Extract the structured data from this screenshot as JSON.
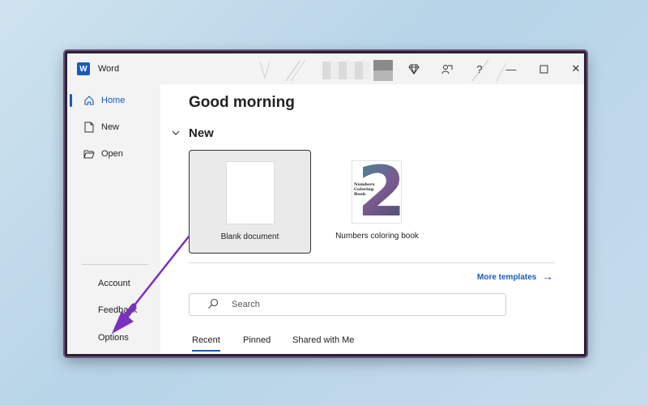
{
  "app": {
    "name": "Word",
    "icon_letter": "W"
  },
  "titlebar": {
    "buttons": [
      "diamond-icon",
      "coauthor-icon",
      "help-icon",
      "minimize-icon",
      "maximize-icon",
      "close-icon"
    ],
    "help_label": "?",
    "minimize_label": "—",
    "close_label": "✕"
  },
  "sidebar": {
    "items": [
      {
        "label": "Home",
        "icon": "home-icon",
        "active": true
      },
      {
        "label": "New",
        "icon": "new-document-icon",
        "active": false
      },
      {
        "label": "Open",
        "icon": "open-folder-icon",
        "active": false
      }
    ],
    "bottom_links": [
      "Account",
      "Feedback",
      "Options"
    ]
  },
  "main": {
    "greeting": "Good morning",
    "new_section": {
      "heading": "New",
      "toggle_icon": "chevron-down-icon"
    },
    "templates": [
      {
        "label": "Blank document",
        "selected": true
      },
      {
        "label": "Numbers coloring book",
        "selected": false,
        "thumb_text": "Numbers Coloring Book",
        "thumb_digit": "2"
      }
    ],
    "more_templates": "More templates",
    "search": {
      "placeholder": "Search"
    },
    "tabs": [
      {
        "label": "Recent",
        "active": true
      },
      {
        "label": "Pinned",
        "active": false
      },
      {
        "label": "Shared with Me",
        "active": false
      }
    ]
  },
  "colors": {
    "accent": "#185abd",
    "annotation_arrow": "#7b2fbe"
  }
}
